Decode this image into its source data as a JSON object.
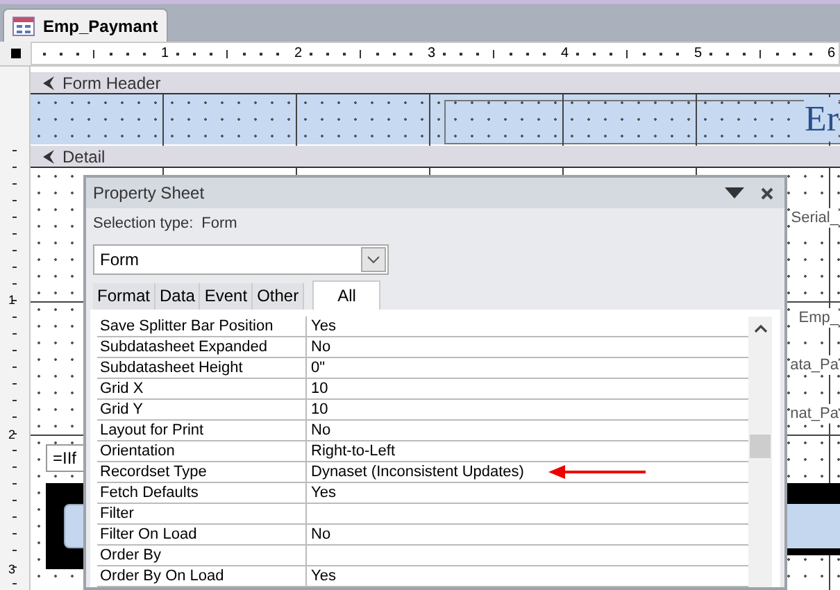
{
  "document_tab": {
    "title": "Emp_Paymant",
    "selected": true
  },
  "ruler": {
    "marks": [
      "1",
      "2",
      "3",
      "4",
      "5",
      "6"
    ]
  },
  "vertical_ruler": {
    "marks": [
      "1",
      "2",
      "3"
    ]
  },
  "sections": [
    {
      "title": "Form Header"
    },
    {
      "title": "Detail"
    }
  ],
  "header_label": "Er",
  "background_labels": [
    {
      "text": "Serial_"
    },
    {
      "text": "Emp_"
    },
    {
      "text": "ata_Pa"
    },
    {
      "text": "nat_Pa"
    }
  ],
  "expression_field": "=IIf",
  "property_sheet": {
    "title": "Property Sheet",
    "selection_type_label": "Selection type:",
    "selection_type": "Form",
    "object_combo": "Form",
    "tabs": [
      {
        "label": "Format",
        "selected": false
      },
      {
        "label": "Data",
        "selected": false
      },
      {
        "label": "Event",
        "selected": false
      },
      {
        "label": "Other",
        "selected": false
      },
      {
        "label": "All",
        "selected": true
      }
    ],
    "properties": [
      {
        "name": "Save Splitter Bar Position",
        "value": "Yes",
        "highlighted": false
      },
      {
        "name": "Subdatasheet Expanded",
        "value": "No",
        "highlighted": false
      },
      {
        "name": "Subdatasheet Height",
        "value": "0\"",
        "highlighted": false
      },
      {
        "name": "Grid X",
        "value": "10",
        "highlighted": false
      },
      {
        "name": "Grid Y",
        "value": "10",
        "highlighted": false
      },
      {
        "name": "Layout for Print",
        "value": "No",
        "highlighted": false
      },
      {
        "name": "Orientation",
        "value": "Right-to-Left",
        "highlighted": false
      },
      {
        "name": "Recordset Type",
        "value": "Dynaset (Inconsistent Updates)",
        "highlighted": true
      },
      {
        "name": "Fetch Defaults",
        "value": "Yes",
        "highlighted": false
      },
      {
        "name": "Filter",
        "highlighted": false
      },
      {
        "name": "Filter On Load",
        "value": "No",
        "highlighted": false
      },
      {
        "name": "Order By",
        "highlighted": false
      },
      {
        "name": "Order By On Load",
        "value": "Yes",
        "highlighted": false
      }
    ]
  }
}
